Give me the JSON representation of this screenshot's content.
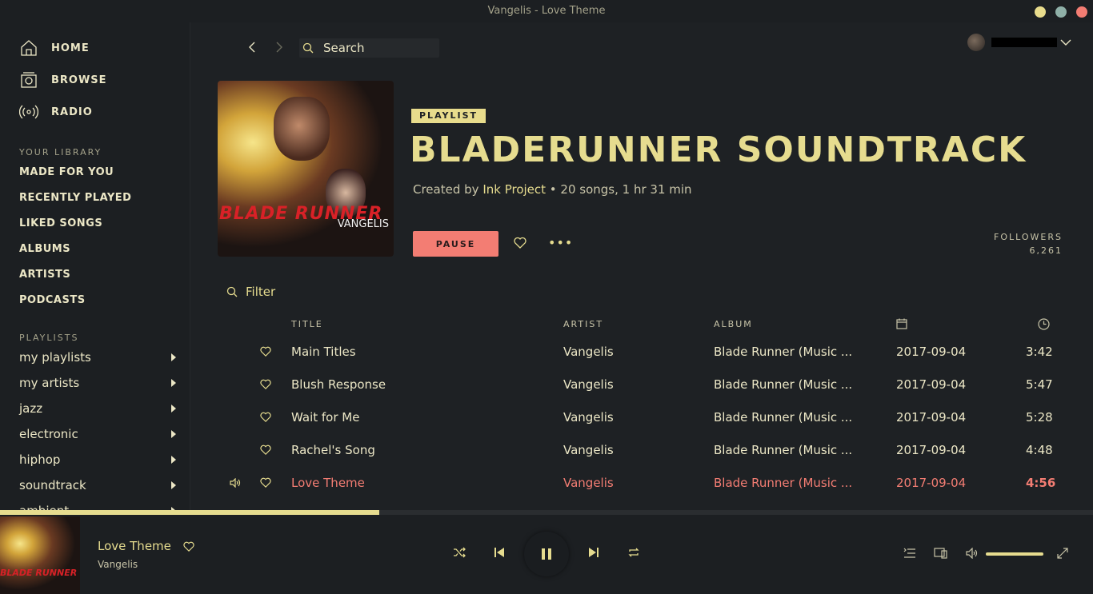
{
  "window": {
    "title": "Vangelis - Love Theme"
  },
  "nav": [
    {
      "label": "HOME",
      "icon": "home-icon"
    },
    {
      "label": "BROWSE",
      "icon": "browse-icon"
    },
    {
      "label": "RADIO",
      "icon": "radio-icon"
    }
  ],
  "library": {
    "title": "YOUR LIBRARY",
    "items": [
      "MADE FOR YOU",
      "RECENTLY PLAYED",
      "LIKED SONGS",
      "ALBUMS",
      "ARTISTS",
      "PODCASTS"
    ]
  },
  "playlists": {
    "title": "PLAYLISTS",
    "items": [
      "my playlists",
      "my artists",
      "jazz",
      "electronic",
      "hiphop",
      "soundtrack",
      "ambient"
    ]
  },
  "search": {
    "placeholder": "Search"
  },
  "playlist": {
    "badge": "PLAYLIST",
    "title": "BLADERUNNER SOUNDTRACK",
    "created_by_prefix": "Created by ",
    "owner": "Ink Project",
    "summary": " • 20 songs, 1 hr 31 min",
    "pause_label": "PAUSE",
    "more_label": "•••",
    "followers_label": "FOLLOWERS",
    "followers_count": "6,261",
    "cover_title": "BLADE RUNNER",
    "cover_artist": "VANGELIS"
  },
  "filter": {
    "placeholder": "Filter"
  },
  "tracklist": {
    "headers": {
      "title": "TITLE",
      "artist": "ARTIST",
      "album": "ALBUM"
    },
    "rows": [
      {
        "title": "Main Titles",
        "artist": "Vangelis",
        "album": "Blade Runner (Music ...",
        "date": "2017-09-04",
        "duration": "3:42",
        "playing": false
      },
      {
        "title": "Blush Response",
        "artist": "Vangelis",
        "album": "Blade Runner (Music ...",
        "date": "2017-09-04",
        "duration": "5:47",
        "playing": false
      },
      {
        "title": "Wait for Me",
        "artist": "Vangelis",
        "album": "Blade Runner (Music ...",
        "date": "2017-09-04",
        "duration": "5:28",
        "playing": false
      },
      {
        "title": "Rachel's Song",
        "artist": "Vangelis",
        "album": "Blade Runner (Music ...",
        "date": "2017-09-04",
        "duration": "4:48",
        "playing": false
      },
      {
        "title": "Love Theme",
        "artist": "Vangelis",
        "album": "Blade Runner (Music ...",
        "date": "2017-09-04",
        "duration": "4:56",
        "playing": true
      }
    ]
  },
  "now_playing": {
    "title": "Love Theme",
    "artist": "Vangelis",
    "progress": 0.347,
    "volume": 1.0,
    "cover_title": "BLADE RUNNER"
  },
  "colors": {
    "accent": "#e6dc8f",
    "playing": "#f37d73",
    "background": "#1e2124",
    "sidebar": "#1c1f22"
  }
}
